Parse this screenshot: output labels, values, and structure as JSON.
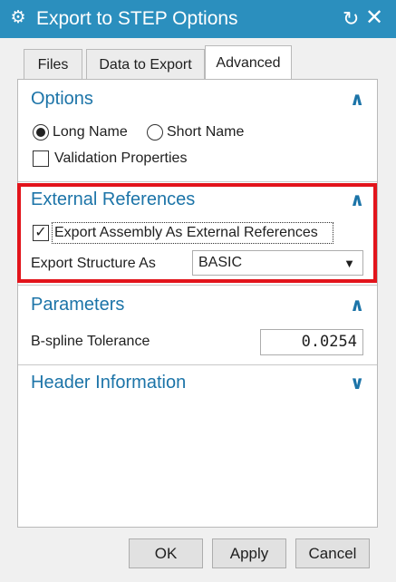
{
  "window": {
    "title": "Export to STEP Options",
    "title_icon": "gear-icon",
    "reset_glyph": "↻",
    "close_glyph": "✕"
  },
  "tabs": [
    {
      "label": "Files"
    },
    {
      "label": "Data to Export"
    },
    {
      "label": "Advanced",
      "active": true
    }
  ],
  "options": {
    "title": "Options",
    "radio_long": "Long Name",
    "radio_short": "Short Name",
    "selected": "Long Name",
    "validation_label": "Validation Properties",
    "validation_checked": false
  },
  "external_references": {
    "title": "External References",
    "export_assembly_label": "Export Assembly As External References",
    "export_assembly_checked": true,
    "structure_label": "Export Structure As",
    "structure_value": "BASIC"
  },
  "parameters": {
    "title": "Parameters",
    "tolerance_label": "B-spline Tolerance",
    "tolerance_value": "0.0254"
  },
  "header_info": {
    "title": "Header Information"
  },
  "buttons": {
    "ok": "OK",
    "apply": "Apply",
    "cancel": "Cancel"
  },
  "colors": {
    "titlebar": "#2b8fbe",
    "section": "#1c74a8",
    "highlight": "#e2141b"
  }
}
